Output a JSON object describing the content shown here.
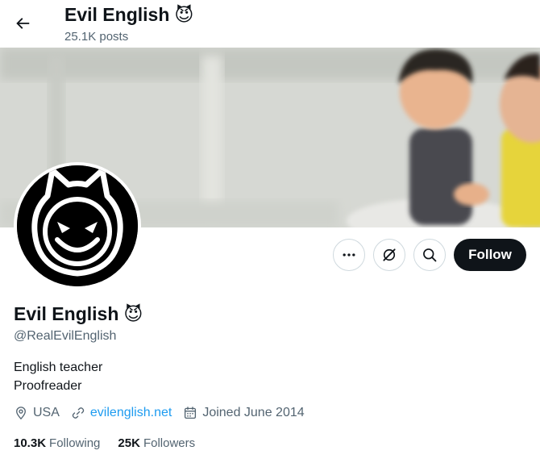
{
  "header": {
    "name": "Evil English",
    "emoji": "😈",
    "posts": "25.1K posts"
  },
  "profile": {
    "display_name": "Evil English",
    "emoji": "😈",
    "handle": "@RealEvilEnglish",
    "bio_lines": [
      "English teacher",
      "Proofreader"
    ],
    "location": "USA",
    "website": "evilenglish.net",
    "joined": "Joined June 2014"
  },
  "stats": {
    "following_count": "10.3K",
    "following_label": "Following",
    "followers_count": "25K",
    "followers_label": "Followers"
  },
  "actions": {
    "follow_label": "Follow"
  },
  "icons": {
    "back": "arrow-left-icon",
    "more": "more-icon",
    "grok": "grok-icon",
    "search": "search-icon",
    "location": "location-icon",
    "link": "link-icon",
    "calendar": "calendar-icon"
  },
  "colors": {
    "text": "#0f1419",
    "muted": "#536471",
    "link": "#1d9bf0",
    "follow_button": "#0f1419",
    "border": "#cfd9de"
  }
}
